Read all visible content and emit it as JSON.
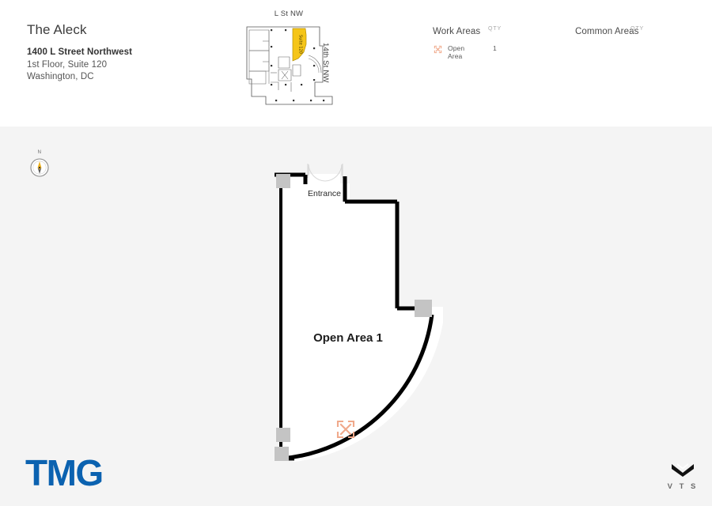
{
  "header": {
    "property_name": "The Aleck",
    "address_line1": "1400 L Street Northwest",
    "address_line2": "1st Floor, Suite 120",
    "address_line3": "Washington, DC"
  },
  "keyplan": {
    "street_top_label": "L St NW",
    "street_right_label": "14th St NW",
    "suite_label": "Suite 120",
    "highlight_color": "#F5C518"
  },
  "legend": {
    "work_areas": {
      "title": "Work Areas",
      "qty_header": "QTY",
      "rows": [
        {
          "icon": "open-area-expand-icon",
          "label": "Open Area",
          "qty": "1"
        }
      ]
    },
    "common_areas": {
      "title": "Common Areas",
      "qty_header": "QTY",
      "rows": []
    }
  },
  "plan": {
    "compass_label": "N",
    "entrance_label": "Entrance",
    "space_label": "Open Area 1",
    "marker_icon": "open-area-expand-icon"
  },
  "branding": {
    "tmg_wordmark": "TMG",
    "vts_wordmark": "V T S",
    "vts_mark_icon": "vts-chevron-icon"
  },
  "colors": {
    "header_background": "#ffffff",
    "canvas_background": "#f4f4f4",
    "wall": "#000000",
    "column": "#c4c4c4",
    "marker_salmon": "#f0a98b",
    "tmg_blue": "#0b62b0",
    "compass_needle": "#efb21e"
  }
}
